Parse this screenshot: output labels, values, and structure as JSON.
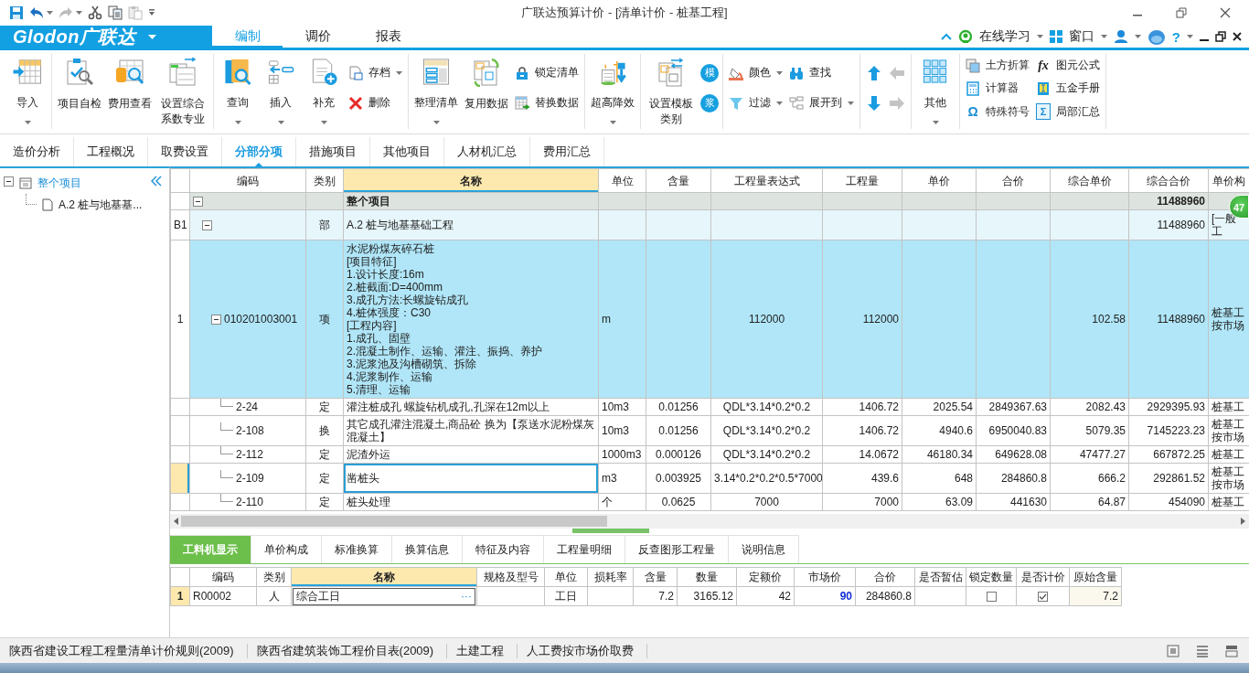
{
  "title_bar": {
    "title": "广联达预算计价 - [清单计价 - 桩基工程]",
    "quick_access": [
      {
        "disabled": false
      },
      {
        "disabled": false
      },
      {
        "disabled": true
      },
      {
        "disabled": false
      },
      {
        "disabled": false
      },
      {
        "disabled": true
      }
    ]
  },
  "menu_bar": {
    "logo": "Glodon广联达",
    "tabs": [
      {
        "label": "编制",
        "selected": true
      },
      {
        "label": "调价",
        "selected": false
      },
      {
        "label": "报表",
        "selected": false
      }
    ],
    "online_learning": "在线学习",
    "window_menu": "窗口",
    "help": "?"
  },
  "ribbon": {
    "groups": [
      {
        "items": [
          {
            "kind": "large",
            "label": "导入",
            "dropdown": true
          }
        ]
      },
      {
        "items": [
          {
            "kind": "large",
            "label": "项目自检"
          },
          {
            "kind": "large",
            "label": "费用查看"
          },
          {
            "kind": "large",
            "label": "设置综合系数专业"
          }
        ]
      },
      {
        "items": [
          {
            "kind": "large",
            "label": "查询",
            "dropdown": true
          },
          {
            "kind": "large",
            "label": "插入",
            "dropdown": true
          },
          {
            "kind": "large",
            "label": "补充",
            "dropdown": true
          },
          {
            "kind": "column",
            "entries": [
              {
                "label": "存档",
                "dropdown": true
              },
              {
                "label": "删除"
              }
            ]
          }
        ]
      },
      {
        "items": [
          {
            "kind": "large",
            "label": "整理清单",
            "dropdown": true
          },
          {
            "kind": "large",
            "label": "复用数据"
          },
          {
            "kind": "column",
            "entries": [
              {
                "label": "锁定清单"
              },
              {
                "label": "替换数据"
              }
            ]
          }
        ]
      },
      {
        "items": [
          {
            "kind": "large",
            "label": "超高降效",
            "dropdown": true
          }
        ]
      },
      {
        "items": [
          {
            "kind": "large",
            "label": "设置模板类别"
          },
          {
            "kind": "column",
            "entries": [
              {
                "glyph": "模"
              },
              {
                "glyph": "浆"
              }
            ]
          }
        ]
      },
      {
        "items": [
          {
            "kind": "column",
            "entries": [
              {
                "label": "颜色",
                "dropdown": true
              },
              {
                "label": "过滤",
                "dropdown": true
              }
            ]
          },
          {
            "kind": "column",
            "entries": [
              {
                "label": "查找"
              },
              {
                "label": "展开到",
                "dropdown": true
              }
            ]
          }
        ]
      },
      {
        "items": [
          {
            "kind": "column",
            "entries": [
              {
                "disabled": false
              },
              {
                "disabled": false
              }
            ]
          },
          {
            "kind": "column",
            "entries": [
              {
                "disabled": true
              },
              {
                "disabled": true
              }
            ]
          }
        ]
      },
      {
        "items": [
          {
            "kind": "large",
            "label": "其他",
            "dropdown": true
          }
        ]
      },
      {
        "items": [
          {
            "kind": "column",
            "entries": [
              {
                "label": "土方折算"
              },
              {
                "label": "计算器"
              },
              {
                "glyph": "Ω",
                "label": "特殊符号"
              }
            ]
          },
          {
            "kind": "column",
            "entries": [
              {
                "glyph": "fx",
                "label": "图元公式"
              },
              {
                "label": "五金手册"
              },
              {
                "glyph": "Σ",
                "label": "局部汇总"
              }
            ]
          }
        ]
      }
    ]
  },
  "page_tabs": [
    {
      "label": "造价分析",
      "selected": false
    },
    {
      "label": "工程概况",
      "selected": false
    },
    {
      "label": "取费设置",
      "selected": false
    },
    {
      "label": "分部分项",
      "selected": true
    },
    {
      "label": "措施项目",
      "selected": false
    },
    {
      "label": "其他项目",
      "selected": false
    },
    {
      "label": "人材机汇总",
      "selected": false
    },
    {
      "label": "费用汇总",
      "selected": false
    }
  ],
  "tree": [
    {
      "label": "整个项目",
      "selected": true,
      "expanded": true,
      "children": [
        {
          "label": "A.2  桩与地基基...",
          "selected": false
        }
      ]
    }
  ],
  "table": {
    "columns": [
      {
        "label": "编码",
        "highlighted": false
      },
      {
        "label": "类别",
        "highlighted": false
      },
      {
        "label": "名称",
        "highlighted": true
      },
      {
        "label": "单位",
        "highlighted": false
      },
      {
        "label": "含量",
        "highlighted": false
      },
      {
        "label": "工程量表达式",
        "highlighted": false
      },
      {
        "label": "工程量",
        "highlighted": false
      },
      {
        "label": "单价",
        "highlighted": false
      },
      {
        "label": "合价",
        "highlighted": false
      },
      {
        "label": "综合单价",
        "highlighted": false
      },
      {
        "label": "综合合价",
        "highlighted": false
      },
      {
        "label": "单价构",
        "highlighted": false
      }
    ],
    "badge": "47",
    "rows": [
      {
        "kind": "total",
        "selected": false,
        "name": "整个项目",
        "comp_total": "11488960",
        "expanded": true,
        "children": [
          {
            "kind": "division",
            "selected": false,
            "row_header": "B1",
            "type": "部",
            "name": "A.2  桩与地基基础工程",
            "comp_total": "11488960",
            "price_basis": "[一般工",
            "expanded": true,
            "children": [
              {
                "kind": "item",
                "selected": false,
                "row_header": "1",
                "code": "010201003001",
                "type": "项",
                "name": "水泥粉煤灰碎石桩\n[项目特征]\n1.设计长度:16m\n2.桩截面:D=400mm\n3.成孔方法:长螺旋钻成孔\n4.桩体强度：C30\n[工程内容]\n1.成孔、固壁\n2.混凝土制作、运输、灌注、振捣、养护\n3.泥浆池及沟槽砌筑、拆除\n4.泥浆制作、运输\n5.清理、运输",
                "unit": "m",
                "expr": "112000",
                "qty": "112000",
                "comp_price": "102.58",
                "comp_total": "11488960",
                "price_basis": "桩基工按市场",
                "expanded": true,
                "children": [
                  {
                    "kind": "quota",
                    "selected": false,
                    "code": "2-24",
                    "type": "定",
                    "name": "灌注桩成孔  螺旋钻机成孔,孔深在12m以上",
                    "unit": "10m3",
                    "content": "0.01256",
                    "expr": "QDL*3.14*0.2*0.2",
                    "qty": "1406.72",
                    "price": "2025.54",
                    "total": "2849367.63",
                    "comp_price": "2082.43",
                    "comp_total": "2929395.93",
                    "price_basis": "桩基工"
                  },
                  {
                    "kind": "quota",
                    "selected": false,
                    "code": "2-108",
                    "type": "换",
                    "name": "其它成孔灌注混凝土,商品砼  换为【泵送水泥粉煤灰混凝土】",
                    "unit": "10m3",
                    "content": "0.01256",
                    "expr": "QDL*3.14*0.2*0.2",
                    "qty": "1406.72",
                    "price": "4940.6",
                    "total": "6950040.83",
                    "comp_price": "5079.35",
                    "comp_total": "7145223.23",
                    "price_basis": "桩基工按市场"
                  },
                  {
                    "kind": "quota",
                    "selected": false,
                    "code": "2-112",
                    "type": "定",
                    "name": "泥渣外运",
                    "unit": "1000m3",
                    "content": "0.000126",
                    "expr": "QDL*3.14*0.2*0.2",
                    "qty": "14.0672",
                    "price": "46180.34",
                    "total": "649628.08",
                    "comp_price": "47477.27",
                    "comp_total": "667872.25",
                    "price_basis": "桩基工"
                  },
                  {
                    "kind": "quota",
                    "selected": true,
                    "code": "2-109",
                    "type": "定",
                    "name": "凿桩头",
                    "unit": "m3",
                    "content": "0.003925",
                    "expr": "3.14*0.2*0.2*0.5*7000",
                    "qty": "439.6",
                    "price": "648",
                    "total": "284860.8",
                    "comp_price": "666.2",
                    "comp_total": "292861.52",
                    "price_basis": "桩基工按市场"
                  },
                  {
                    "kind": "quota",
                    "selected": false,
                    "code": "2-110",
                    "type": "定",
                    "name": "桩头处理",
                    "unit": "个",
                    "content": "0.0625",
                    "expr": "7000",
                    "qty": "7000",
                    "price": "63.09",
                    "total": "441630",
                    "comp_price": "64.87",
                    "comp_total": "454090",
                    "price_basis": "桩基工"
                  }
                ]
              }
            ]
          }
        ]
      }
    ]
  },
  "detail": {
    "tabs": [
      {
        "label": "工料机显示",
        "selected": true
      },
      {
        "label": "单价构成",
        "selected": false
      },
      {
        "label": "标准换算",
        "selected": false
      },
      {
        "label": "换算信息",
        "selected": false
      },
      {
        "label": "特征及内容",
        "selected": false
      },
      {
        "label": "工程量明细",
        "selected": false
      },
      {
        "label": "反查图形工程量",
        "selected": false
      },
      {
        "label": "说明信息",
        "selected": false
      }
    ],
    "columns": [
      {
        "label": "编码",
        "highlighted": false
      },
      {
        "label": "类别",
        "highlighted": false
      },
      {
        "label": "名称",
        "highlighted": true
      },
      {
        "label": "规格及型号",
        "highlighted": false
      },
      {
        "label": "单位",
        "highlighted": false
      },
      {
        "label": "损耗率",
        "highlighted": false
      },
      {
        "label": "含量",
        "highlighted": false
      },
      {
        "label": "数量",
        "highlighted": false
      },
      {
        "label": "定额价",
        "highlighted": false
      },
      {
        "label": "市场价",
        "highlighted": false
      },
      {
        "label": "合价",
        "highlighted": false
      },
      {
        "label": "是否暂估",
        "highlighted": false
      },
      {
        "label": "锁定数量",
        "highlighted": false
      },
      {
        "label": "是否计价",
        "highlighted": false
      },
      {
        "label": "原始含量",
        "highlighted": false
      }
    ],
    "rows": [
      {
        "row_header": "1",
        "selected": true,
        "code": "R00002",
        "type": "人",
        "name": "综合工日",
        "name_button": "···",
        "unit": "工日",
        "content": "7.2",
        "qty": "3165.12",
        "quota_price": "42",
        "market_price": "90",
        "market_price_modified": true,
        "total": "284860.8",
        "locked": false,
        "priced": true,
        "original_content": "7.2"
      }
    ]
  },
  "status_bar": {
    "items": [
      "陕西省建设工程工程量清单计价规则(2009)",
      "陕西省建筑装饰工程价目表(2009)",
      "土建工程",
      "人工费按市场价取费"
    ]
  }
}
